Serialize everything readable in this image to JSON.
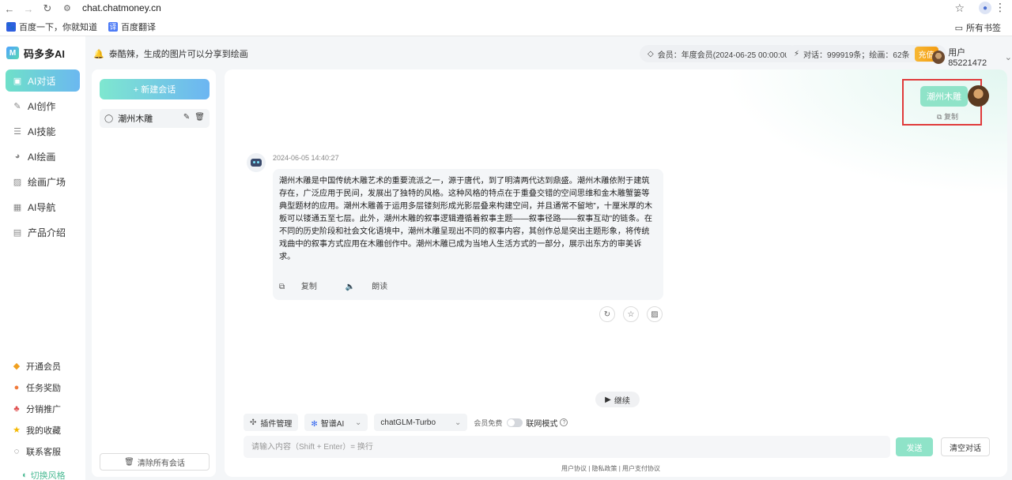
{
  "browser": {
    "url": "chat.chatmoney.cn",
    "bookmarks": [
      {
        "label": "百度一下，你就知道"
      },
      {
        "label": "百度翻译"
      }
    ],
    "all_bookmarks": "所有书签"
  },
  "app": {
    "logo": "码多多AI",
    "notice": "泰酷辣，生成的图片可以分享到绘画",
    "member": "会员：年度会员(2024-06-25 00:00:00)",
    "stats": "对话：999919条；绘画：62条",
    "recharge": "充值",
    "username": "用户85221472"
  },
  "sidebar": {
    "items": [
      {
        "label": "AI对话",
        "icon": "chat-icon"
      },
      {
        "label": "AI创作",
        "icon": "pen-icon"
      },
      {
        "label": "AI技能",
        "icon": "list-icon"
      },
      {
        "label": "AI绘画",
        "icon": "palette-icon"
      },
      {
        "label": "绘画广场",
        "icon": "image-icon"
      },
      {
        "label": "AI导航",
        "icon": "grid-icon"
      },
      {
        "label": "产品介绍",
        "icon": "doc-icon"
      }
    ],
    "bottom": [
      {
        "label": "开通会员"
      },
      {
        "label": "任务奖励"
      },
      {
        "label": "分销推广"
      },
      {
        "label": "我的收藏"
      },
      {
        "label": "联系客服"
      }
    ],
    "theme_switch": "切换风格"
  },
  "conversations": {
    "new_chat": "+ 新建会话",
    "items": [
      {
        "title": "潮州木雕"
      }
    ],
    "clear_all": "清除所有会话"
  },
  "chat": {
    "user_message": "潮州木雕",
    "user_copy": "复制",
    "bot_time": "2024-06-05 14:40:27",
    "bot_message": "潮州木雕是中国传统木雕艺术的重要流派之一，源于唐代，到了明清两代达到鼎盛。潮州木雕依附于建筑存在，广泛应用于民间，发展出了独特的风格。这种风格的特点在于重叠交错的空间思维和金木雕蟹篓等典型题材的应用。潮州木雕善于运用多层镂刻形成光影层叠来构建空间，并且通常不留地”，十厘米厚的木板可以镂通五至七层。此外，潮州木雕的叙事逻辑遵循着叙事主题——叙事径路——叙事互动”的链条。在不同的历史阶段和社会文化语境中，潮州木雕呈现出不同的叙事内容，其创作总是突出主题形象，将传统戏曲中的叙事方式应用在木雕创作中。潮州木雕已成为当地人生活方式的一部分，展示出东方的审美诉求。",
    "bot_copy": "复制",
    "bot_read": "朗读",
    "continue": "继续"
  },
  "composer": {
    "plugin": "插件管理",
    "provider": "智谱AI",
    "model": "chatGLM-Turbo",
    "free_label": "会员免费",
    "web_mode": "联网模式",
    "placeholder": "请输入内容（Shift + Enter）= 换行",
    "send": "发送",
    "clear": "清空对话"
  },
  "footer": "用户协议 | 隐私政策 | 用户支付协议"
}
